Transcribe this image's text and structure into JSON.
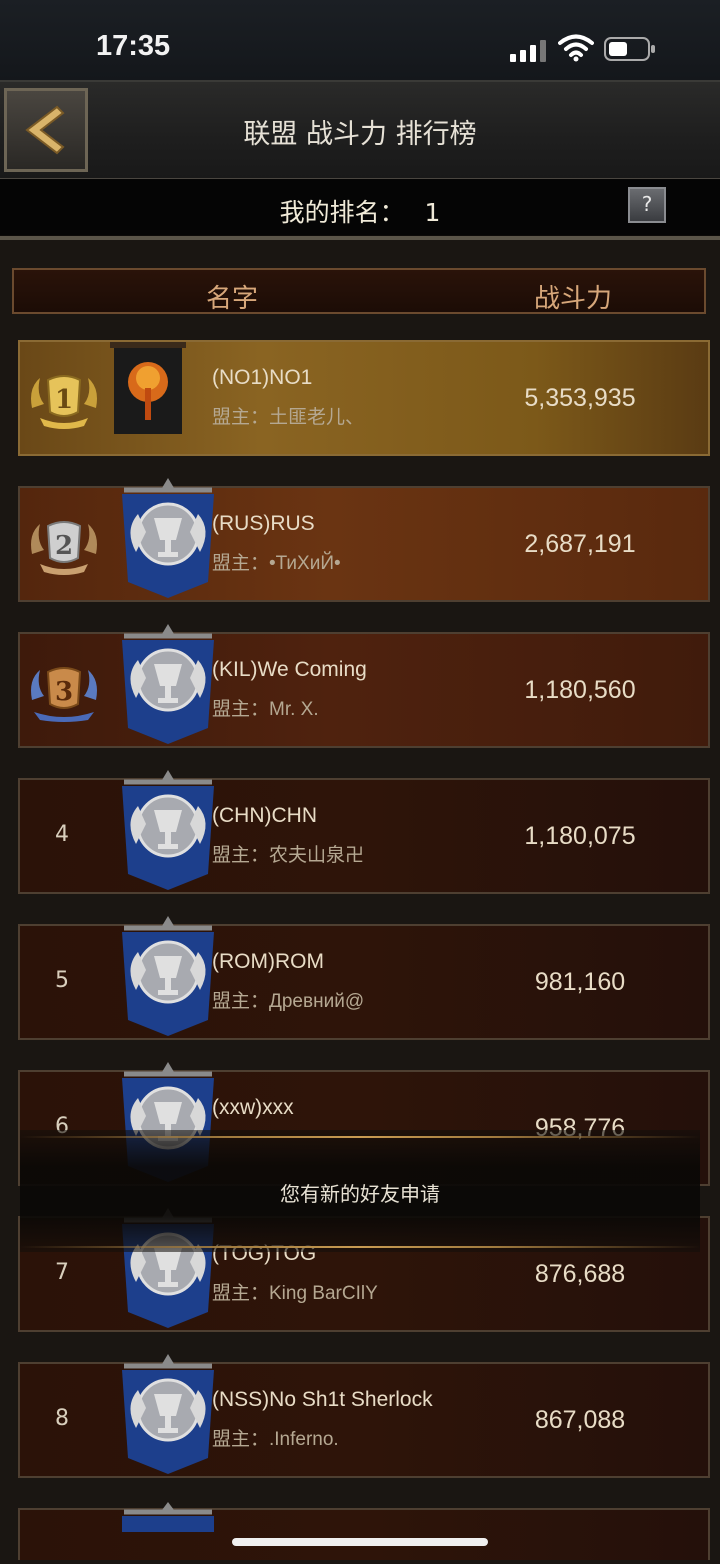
{
  "status_bar": {
    "time": "17:35"
  },
  "header": {
    "title": "联盟 战斗力 排行榜"
  },
  "my_rank": {
    "label": "我的排名：",
    "value": "1",
    "help": "?"
  },
  "columns": {
    "name": "名字",
    "power": "战斗力"
  },
  "rows": [
    {
      "rank": "1",
      "alliance": "(NO1)NO1",
      "leader": "盟主：土匪老儿、",
      "power": "5,353,935"
    },
    {
      "rank": "2",
      "alliance": "(RUS)RUS",
      "leader": "盟主：•ТиХиЙ•",
      "power": "2,687,191"
    },
    {
      "rank": "3",
      "alliance": "(KIL)We Coming",
      "leader": "盟主：Mr. X.",
      "power": "1,180,560"
    },
    {
      "rank": "4",
      "alliance": "(CHN)CHN",
      "leader": "盟主：农夫山泉卍",
      "power": "1,180,075"
    },
    {
      "rank": "5",
      "alliance": "(ROM)ROM",
      "leader": "盟主：Древний@",
      "power": "981,160"
    },
    {
      "rank": "6",
      "alliance": "(xxw)xxx",
      "leader": "",
      "power": "958,776"
    },
    {
      "rank": "7",
      "alliance": "(TOG)TOG",
      "leader": "盟主：King BarCIlY",
      "power": "876,688"
    },
    {
      "rank": "8",
      "alliance": "(NSS)No Sh1t Sherlock",
      "leader": "盟主：.Inferno.",
      "power": "867,088"
    }
  ],
  "toast": {
    "message": "您有新的好友申请"
  },
  "colors": {
    "gold_row": "#8a6422",
    "row_bg": "#2e1409",
    "banner_blue": "#1d3f8c"
  }
}
